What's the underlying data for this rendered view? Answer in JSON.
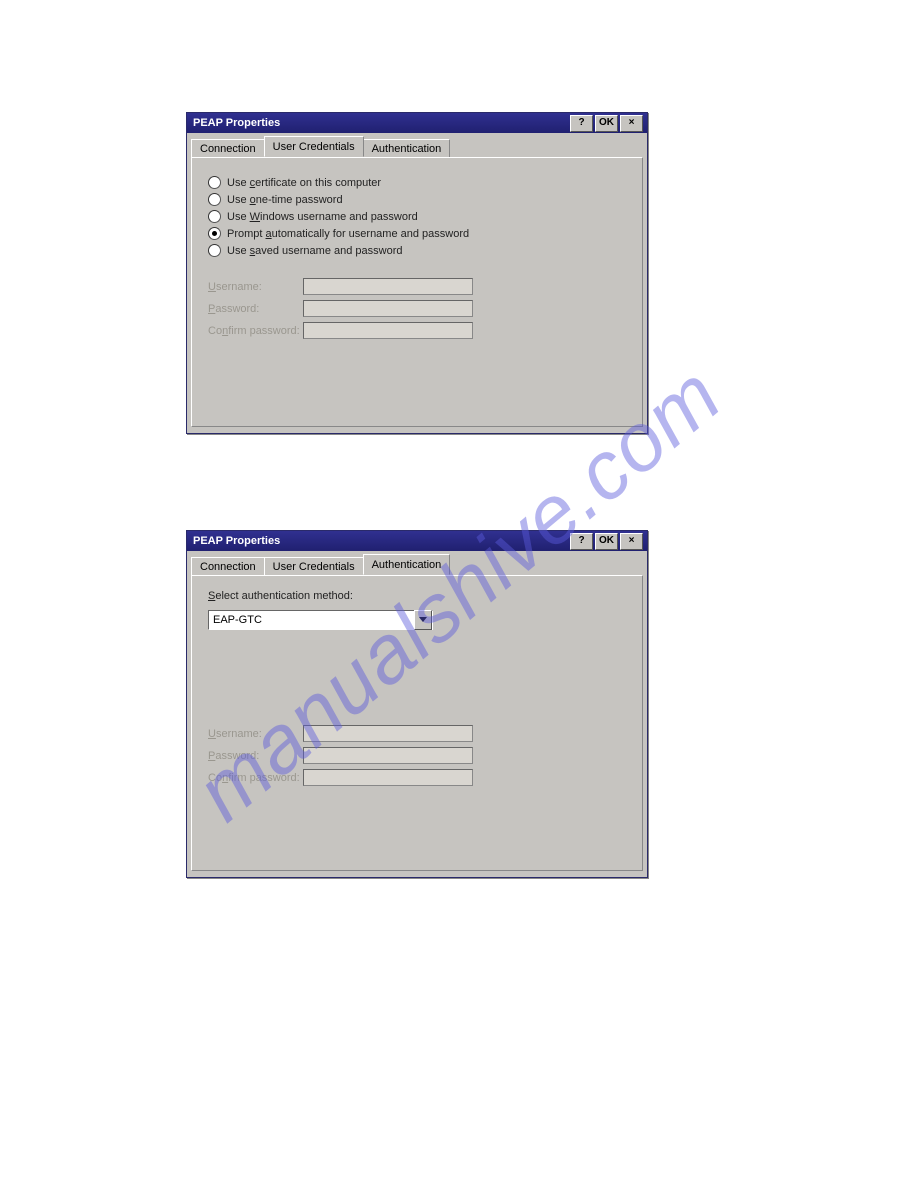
{
  "watermark": "manualshive.com",
  "dialog1": {
    "title": "PEAP Properties",
    "help": "?",
    "ok": "OK",
    "close": "×",
    "tabs": {
      "connection": "Connection",
      "user_credentials": "User Credentials",
      "authentication": "Authentication"
    },
    "radios": {
      "cert_pre": "Use ",
      "cert_u": "c",
      "cert_post": "ertificate on this computer",
      "one_pre": "Use ",
      "one_u": "o",
      "one_post": "ne-time password",
      "win_pre": "Use ",
      "win_u": "W",
      "win_post": "indows username and password",
      "prompt_pre": "Prompt ",
      "prompt_u": "a",
      "prompt_post": "utomatically for username and password",
      "saved_pre": "Use ",
      "saved_u": "s",
      "saved_post": "aved username and password"
    },
    "fields": {
      "username_u": "U",
      "username_post": "sername:",
      "password_u": "P",
      "password_post": "assword:",
      "confirm_pre": "Co",
      "confirm_u": "n",
      "confirm_post": "firm password:"
    }
  },
  "dialog2": {
    "title": "PEAP Properties",
    "help": "?",
    "ok": "OK",
    "close": "×",
    "tabs": {
      "connection": "Connection",
      "user_credentials": "User Credentials",
      "authentication": "Authentication"
    },
    "select_u": "S",
    "select_post": "elect authentication method:",
    "combo_value": "EAP-GTC",
    "fields": {
      "username_u": "U",
      "username_post": "sername:",
      "password_u": "P",
      "password_post": "assword:",
      "confirm_pre": "Co",
      "confirm_u": "n",
      "confirm_post": "firm password:"
    }
  }
}
